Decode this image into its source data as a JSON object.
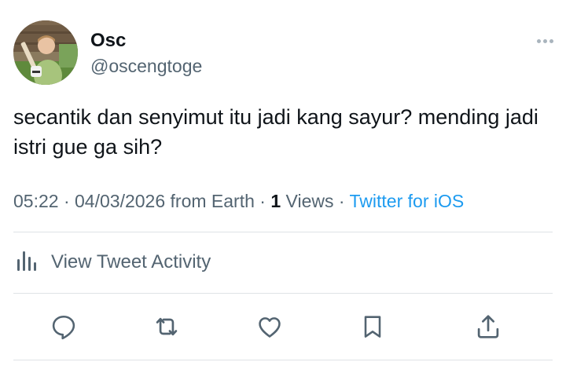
{
  "author": {
    "name": "Osc",
    "handle": "@oscengtoge",
    "avatar_icon": "profile-photo"
  },
  "tweet": {
    "text": "secantik dan senyimut itu jadi kang sayur? mending jadi istri gue ga sih?",
    "time": "05:22",
    "date": "04/03/2026",
    "location": "from Earth",
    "views_count": "1",
    "views_label": "Views",
    "source": "Twitter for iOS",
    "separator": "·"
  },
  "activity": {
    "label": "View Tweet Activity",
    "icon": "analytics-bars-icon"
  },
  "actions": [
    {
      "name": "reply",
      "icon": "reply-bubble-icon"
    },
    {
      "name": "retweet",
      "icon": "retweet-icon"
    },
    {
      "name": "like",
      "icon": "heart-icon"
    },
    {
      "name": "bookmark",
      "icon": "bookmark-icon"
    },
    {
      "name": "share",
      "icon": "share-icon"
    }
  ],
  "colors": {
    "text": "#0f1419",
    "secondary": "#536471",
    "link": "#1d9bf0",
    "divider": "#dfe3e6"
  }
}
